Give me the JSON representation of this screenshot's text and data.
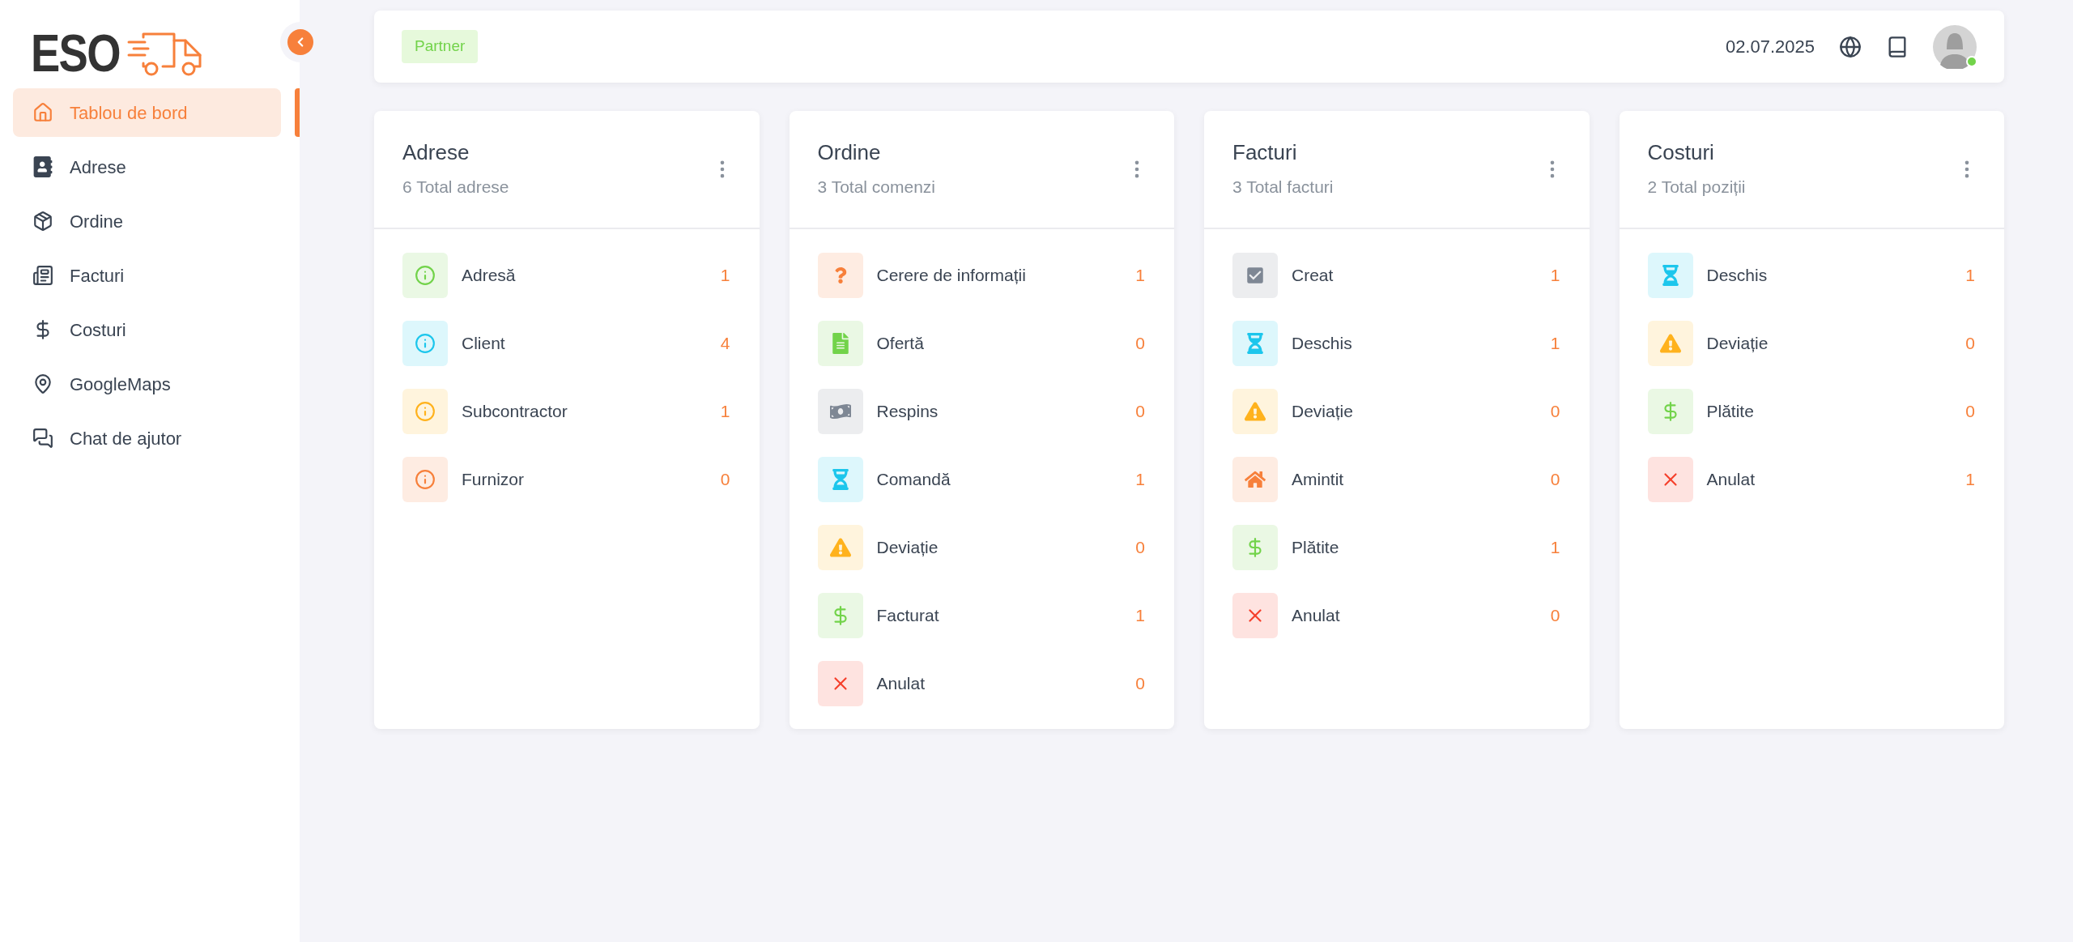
{
  "sidebar": {
    "logo": "ESO",
    "collapsed": false,
    "items": [
      {
        "label": "Tablou de bord",
        "selected": true
      },
      {
        "label": "Adrese",
        "selected": false
      },
      {
        "label": "Ordine",
        "selected": false
      },
      {
        "label": "Facturi",
        "selected": false
      },
      {
        "label": "Costuri",
        "selected": false
      },
      {
        "label": "GoogleMaps",
        "selected": false
      },
      {
        "label": "Chat de ajutor",
        "selected": false
      }
    ]
  },
  "header": {
    "badge": "Partner",
    "date": "02.07.2025",
    "user_online": true
  },
  "cards": [
    {
      "title": "Adrese",
      "subtitle": "6 Total adrese",
      "rows": [
        {
          "label": "Adresă",
          "value": "1",
          "color": "#72d34a"
        },
        {
          "label": "Client",
          "value": "4",
          "color": "#1cc6ec"
        },
        {
          "label": "Subcontractor",
          "value": "1",
          "color": "#ffb21d"
        },
        {
          "label": "Furnizor",
          "value": "0",
          "color": "#f7803b"
        }
      ]
    },
    {
      "title": "Ordine",
      "subtitle": "3 Total comenzi",
      "rows": [
        {
          "label": "Cerere de informații",
          "value": "1",
          "color": "#f7803b"
        },
        {
          "label": "Ofertă",
          "value": "0",
          "color": "#72d34a"
        },
        {
          "label": "Respins",
          "value": "0",
          "color": "#7e8794"
        },
        {
          "label": "Comandă",
          "value": "1",
          "color": "#1cc6ec"
        },
        {
          "label": "Deviație",
          "value": "0",
          "color": "#ffb21d"
        },
        {
          "label": "Facturat",
          "value": "1",
          "color": "#72d34a"
        },
        {
          "label": "Anulat",
          "value": "0",
          "color": "#f5402c"
        }
      ]
    },
    {
      "title": "Facturi",
      "subtitle": "3 Total facturi",
      "rows": [
        {
          "label": "Creat",
          "value": "1",
          "color": "#7e8794"
        },
        {
          "label": "Deschis",
          "value": "1",
          "color": "#1cc6ec"
        },
        {
          "label": "Deviație",
          "value": "0",
          "color": "#ffb21d"
        },
        {
          "label": "Amintit",
          "value": "0",
          "color": "#f7803b"
        },
        {
          "label": "Plătite",
          "value": "1",
          "color": "#72d34a"
        },
        {
          "label": "Anulat",
          "value": "0",
          "color": "#f5402c"
        }
      ]
    },
    {
      "title": "Costuri",
      "subtitle": "2 Total poziții",
      "rows": [
        {
          "label": "Deschis",
          "value": "1",
          "color": "#1cc6ec"
        },
        {
          "label": "Deviație",
          "value": "0",
          "color": "#ffb21d"
        },
        {
          "label": "Plătite",
          "value": "0",
          "color": "#72d34a"
        },
        {
          "label": "Anulat",
          "value": "1",
          "color": "#f5402c"
        }
      ]
    }
  ]
}
